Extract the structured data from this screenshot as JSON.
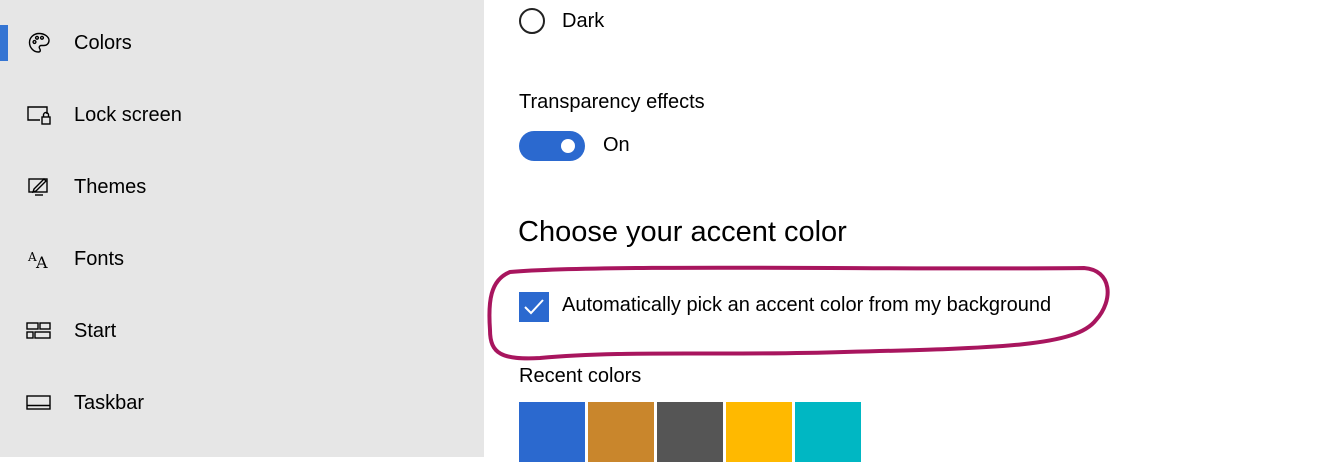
{
  "sidebar": {
    "items": [
      {
        "label": "Colors",
        "icon": "palette-icon"
      },
      {
        "label": "Lock screen",
        "icon": "lock-screen-icon"
      },
      {
        "label": "Themes",
        "icon": "themes-icon"
      },
      {
        "label": "Fonts",
        "icon": "fonts-icon"
      },
      {
        "label": "Start",
        "icon": "start-icon"
      },
      {
        "label": "Taskbar",
        "icon": "taskbar-icon"
      }
    ],
    "active_index": 0
  },
  "main": {
    "mode_option": {
      "label": "Dark",
      "selected": false
    },
    "transparency": {
      "label": "Transparency effects",
      "state_label": "On",
      "on": true
    },
    "accent_section": {
      "title": "Choose your accent color",
      "auto_pick_label": "Automatically pick an accent color from my background",
      "auto_pick_checked": true
    },
    "recent_colors": {
      "label": "Recent colors",
      "swatches": [
        "#2b69cf",
        "#c9862c",
        "#555555",
        "#ffb900",
        "#00b7c3"
      ]
    }
  },
  "colors": {
    "accent": "#2b69cf",
    "annotation_stroke": "#a8155e",
    "sidebar_bg": "#e6e6e6"
  }
}
